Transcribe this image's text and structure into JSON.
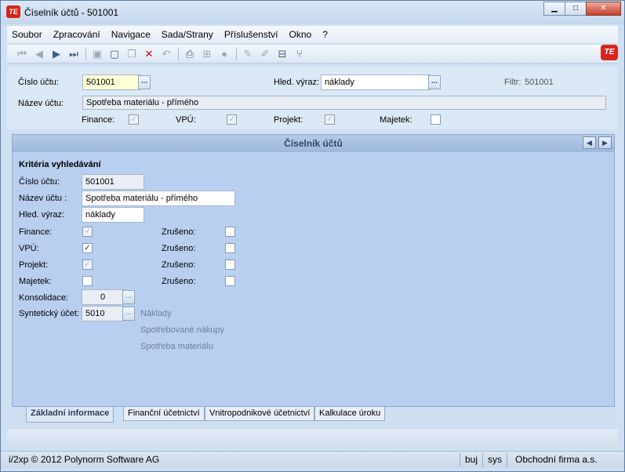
{
  "window": {
    "title": "Číselník účtů - 501001",
    "app_logo": "TE",
    "buttons": {
      "minimize": "▁",
      "maximize": "□",
      "close": "✕"
    }
  },
  "menu": [
    "Soubor",
    "Zpracování",
    "Navigace",
    "Sada/Strany",
    "Příslušenství",
    "Okno",
    "?"
  ],
  "toolbar_icons": [
    "first-record-icon",
    "prev-record-icon",
    "next-record-icon",
    "last-record-icon",
    "save-icon",
    "new-icon",
    "copy-icon",
    "delete-icon",
    "undo-icon",
    "print-icon",
    "tree-icon",
    "circle-icon",
    "edit-icon",
    "edit2-icon",
    "export-icon",
    "filter-icon"
  ],
  "header": {
    "account_number_label": "Číslo účtu:",
    "account_number_value": "501001",
    "search_expr_label": "Hled. výraz:",
    "search_expr_value": "náklady",
    "filter_label": "Filtr:",
    "filter_value": "501001",
    "account_name_label": "Název účtu:",
    "account_name_value": "Spotřeba materiálu - přímého",
    "checks": [
      {
        "label": "Finance:",
        "checked": true
      },
      {
        "label": "VPÚ:",
        "checked": true
      },
      {
        "label": "Projekt:",
        "checked": true
      },
      {
        "label": "Majetek:",
        "checked": false
      }
    ]
  },
  "panel": {
    "title": "Číselník účtů",
    "section_title": "Kritéria vyhledávání",
    "account_number_label": "Číslo účtu:",
    "account_number_value": "501001",
    "account_name_label": "Název účtu :",
    "account_name_value": "Spotřeba materiálu - přímého",
    "search_expr_label": "Hled. výraz:",
    "search_expr_value": "náklady",
    "rows": [
      {
        "label": "Finance:",
        "checked": true,
        "dark": false,
        "cancel_label": "Zrušeno:",
        "cancel_checked": false
      },
      {
        "label": "VPÚ:",
        "checked": true,
        "dark": true,
        "cancel_label": "Zrušeno:",
        "cancel_checked": false
      },
      {
        "label": "Projekt:",
        "checked": true,
        "dark": false,
        "cancel_label": "Zrušeno:",
        "cancel_checked": false
      },
      {
        "label": "Majetek:",
        "checked": false,
        "dark": false,
        "cancel_label": "Zrušeno:",
        "cancel_checked": false
      }
    ],
    "consolidation_label": "Konsolidace:",
    "consolidation_value": "0",
    "synthetic_label": "Syntetický účet:",
    "synthetic_value": "5010",
    "synthetic_desc": [
      "Náklady",
      "Spotřebované nákupy",
      "Spotřeba materiálu"
    ]
  },
  "tabs": [
    "Základní informace",
    "Finanční účetnictví",
    "Vnitropodnikové účetnictví",
    "Kalkulace úroku"
  ],
  "status": {
    "copyright": "i/2xp © 2012 Polynorm Software AG",
    "user": "buj",
    "db": "sys",
    "company": "Obchodní firma a.s."
  }
}
